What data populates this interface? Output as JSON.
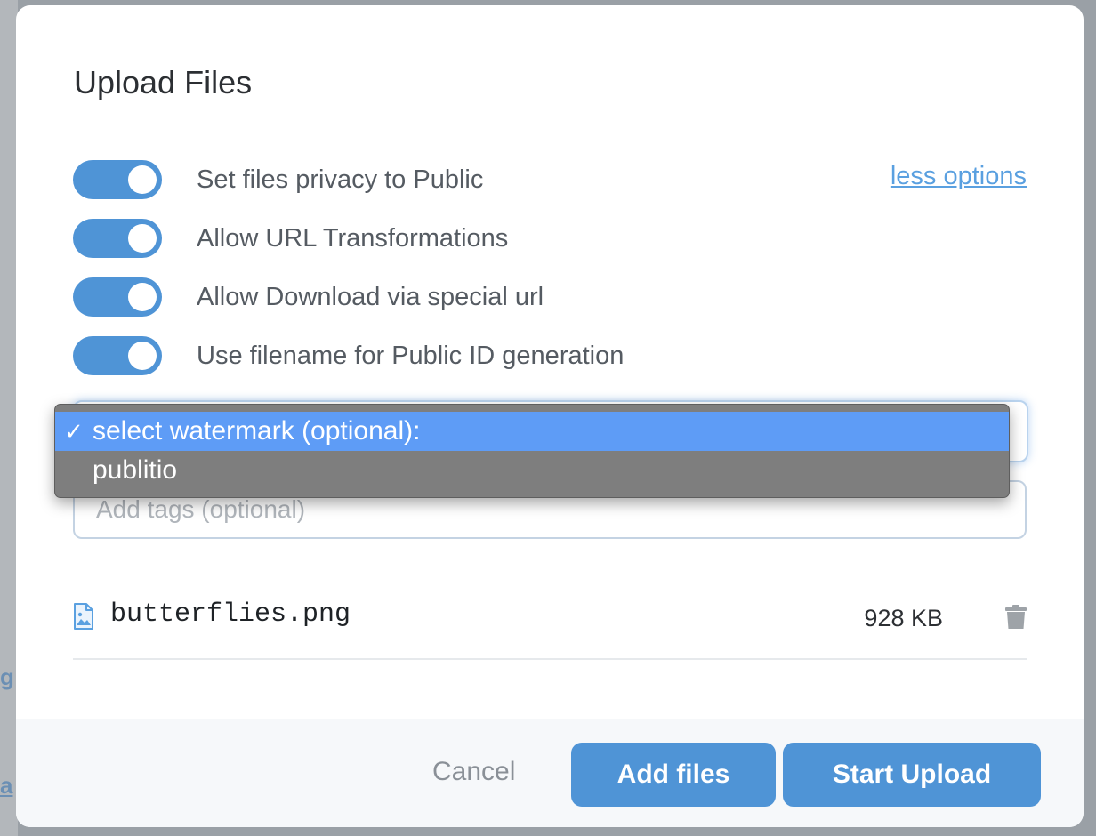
{
  "backdrop": {
    "fragments": [
      "g",
      "a"
    ]
  },
  "modal": {
    "title": "Upload Files",
    "less_options_link": "less options",
    "toggles": [
      {
        "label": "Set files privacy to Public",
        "on": true
      },
      {
        "label": "Allow URL Transformations",
        "on": true
      },
      {
        "label": "Allow Download via special url",
        "on": true
      },
      {
        "label": "Use filename for Public ID generation",
        "on": true
      }
    ],
    "watermark_select": {
      "options": [
        {
          "label": "select watermark (optional):",
          "selected": true,
          "check": "✓"
        },
        {
          "label": "publitio",
          "selected": false,
          "check": ""
        }
      ]
    },
    "tags_input": {
      "placeholder": "Add tags (optional)",
      "value": ""
    },
    "files": [
      {
        "name": "butterflies.png",
        "size": "928 KB",
        "icon": "image-file-icon",
        "delete_icon": "trash-icon"
      }
    ],
    "footer": {
      "cancel_label": "Cancel",
      "add_files_label": "Add files",
      "start_upload_label": "Start Upload"
    }
  },
  "colors": {
    "accent": "#4f94d6",
    "link": "#5aa0e0",
    "dropdown_highlight": "#5e9cf6",
    "dropdown_bg": "#7e7e7e",
    "backdrop": "#9aa0a6"
  }
}
